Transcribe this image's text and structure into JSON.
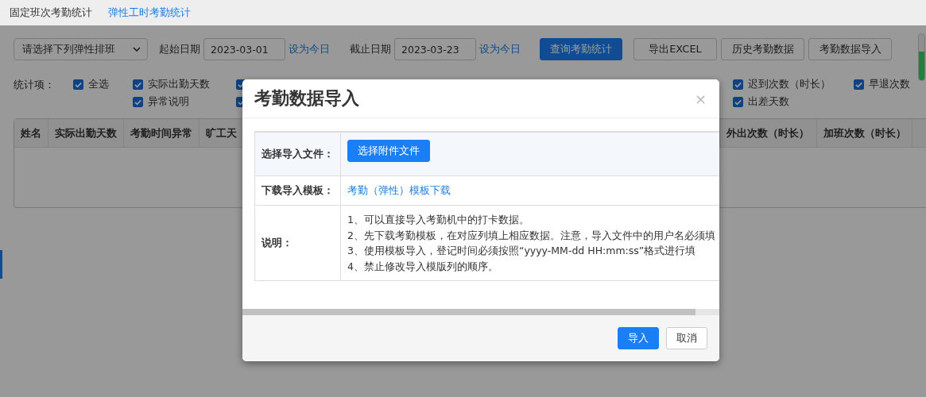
{
  "tabs": [
    {
      "label": "固定班次考勤统计",
      "selected": false
    },
    {
      "label": "弹性工时考勤统计",
      "selected": true
    }
  ],
  "filter": {
    "shift_select": {
      "value": "请选择下列弹性排班"
    },
    "start": {
      "label": "起始日期",
      "value": "2023-03-01",
      "today_link": "设为今日"
    },
    "end": {
      "label": "截止日期",
      "value": "2023-03-23",
      "today_link": "设为今日"
    },
    "buttons": [
      {
        "label": "查询考勤统计",
        "kind": "primary"
      },
      {
        "label": "导出EXCEL",
        "kind": "default"
      },
      {
        "label": "历史考勤数据",
        "kind": "default"
      },
      {
        "label": "考勤数据导入",
        "kind": "default"
      }
    ]
  },
  "stat_items": {
    "label": "统计项：",
    "rows": [
      [
        {
          "label": "全选",
          "checked": true
        },
        {
          "label": "实际出勤天数",
          "checked": true
        },
        {
          "checked": true
        },
        {
          "label": "迟到次数（时长）",
          "checked": true
        },
        {
          "label": "早退次数",
          "checked": true
        }
      ],
      [
        "",
        {
          "label": "异常说明",
          "checked": true
        },
        {
          "checked": true
        },
        {
          "label": "出差天数",
          "checked": true
        }
      ]
    ]
  },
  "table": {
    "columns": [
      "姓名",
      "实际出勤天数",
      "考勤时间异常",
      "旷工天",
      "外出次数（时长）",
      "加班次数（时长）"
    ]
  },
  "dialog": {
    "title": "考勤数据导入",
    "close": "×",
    "rows": [
      {
        "label": "选择导入文件：",
        "kind": "button",
        "value": "选择附件文件"
      },
      {
        "label": "下载导入模板：",
        "kind": "link",
        "value": "考勤（弹性）模板下载"
      },
      {
        "label": "说明：",
        "kind": "notes",
        "lines": [
          "1、可以直接导入考勤机中的打卡数据。",
          "2、先下载考勤模板，在对应列填上相应数据。注意，导入文件中的用户名必须填",
          "3、使用模板导入，登记时间必须按照“yyyy-MM-dd HH:mm:ss”格式进行填",
          "4、禁止修改导入模版列的顺序。"
        ]
      }
    ],
    "buttons": [
      {
        "label": "导入",
        "kind": "primary"
      },
      {
        "label": "取消",
        "kind": "default"
      }
    ]
  }
}
